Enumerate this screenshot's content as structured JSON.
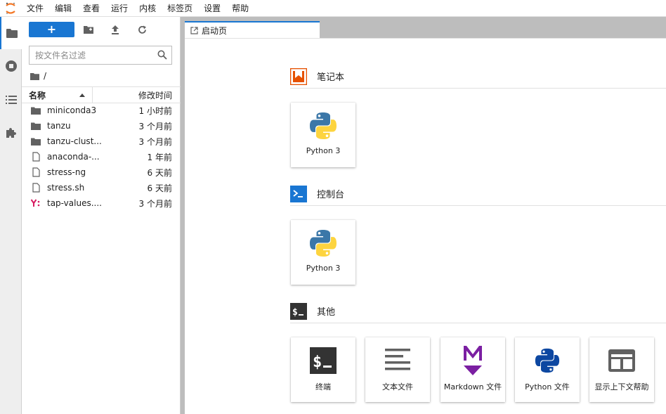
{
  "menubar": {
    "items": [
      "文件",
      "编辑",
      "查看",
      "运行",
      "内核",
      "标签页",
      "设置",
      "帮助"
    ]
  },
  "filebrowser": {
    "new_label": "+",
    "filter_placeholder": "按文件名过滤",
    "breadcrumb": "/",
    "col_name": "名称",
    "col_modified": "修改时间",
    "files": [
      {
        "name": "miniconda3",
        "modified": "1 小时前",
        "icon": "folder-icon"
      },
      {
        "name": "tanzu",
        "modified": "3 个月前",
        "icon": "folder-icon"
      },
      {
        "name": "tanzu-clust...",
        "modified": "3 个月前",
        "icon": "folder-icon"
      },
      {
        "name": "anaconda-...",
        "modified": "1 年前",
        "icon": "file-icon"
      },
      {
        "name": "stress-ng",
        "modified": "6 天前",
        "icon": "file-icon"
      },
      {
        "name": "stress.sh",
        "modified": "6 天前",
        "icon": "file-icon"
      },
      {
        "name": "tap-values....",
        "modified": "3 个月前",
        "icon": "yaml-icon"
      }
    ]
  },
  "tabs": [
    {
      "label": "启动页"
    }
  ],
  "launcher": {
    "notebook": {
      "title": "笔记本",
      "cards": [
        {
          "label": "Python 3"
        }
      ]
    },
    "console": {
      "title": "控制台",
      "cards": [
        {
          "label": "Python 3"
        }
      ]
    },
    "other": {
      "title": "其他",
      "cards": [
        {
          "label": "终端"
        },
        {
          "label": "文本文件"
        },
        {
          "label": "Markdown 文件"
        },
        {
          "label": "Python 文件"
        },
        {
          "label": "显示上下文帮助"
        }
      ]
    }
  },
  "colors": {
    "accent": "#1976d2",
    "notebook": "#e65100",
    "console": "#1976d2",
    "markdown": "#7b1fa2",
    "python_blue": "#0d47a1",
    "sidebar_bg": "#eeeeee",
    "splitter": "#bdbdbd"
  }
}
